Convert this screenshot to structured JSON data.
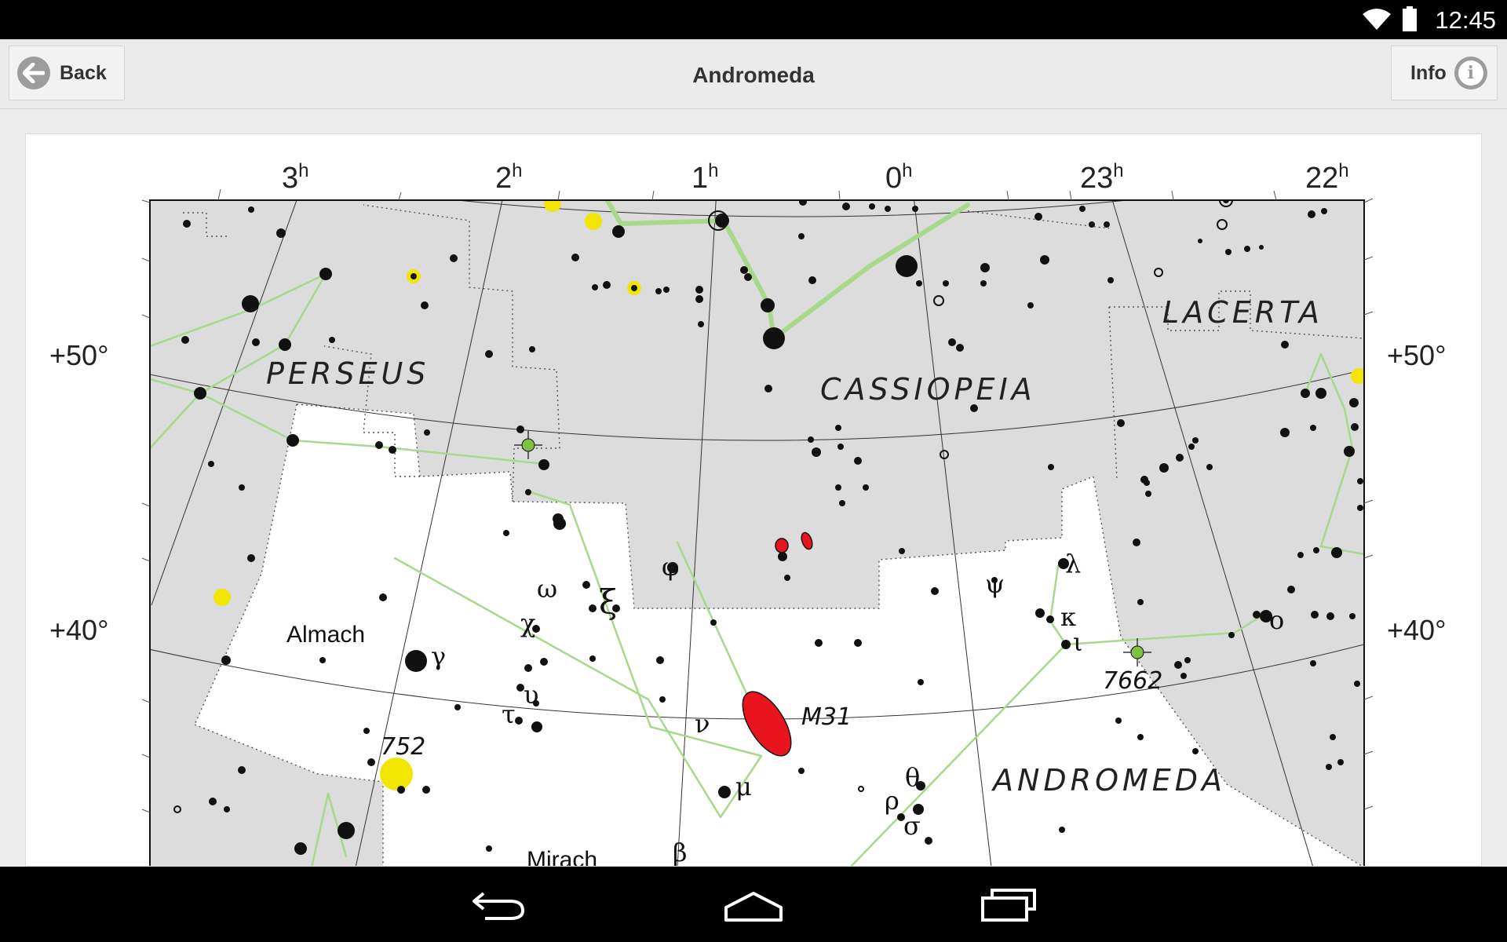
{
  "status_bar": {
    "time": "12:45",
    "icons": [
      "wifi-icon",
      "battery-icon"
    ]
  },
  "action_bar": {
    "title": "Andromeda",
    "back_label": "Back",
    "info_label": "Info",
    "back_icon": "arrow-left-icon",
    "info_icon": "info-icon"
  },
  "star_map": {
    "ra_labels": [
      {
        "h": "3",
        "sup": "h"
      },
      {
        "h": "2",
        "sup": "h"
      },
      {
        "h": "1",
        "sup": "h"
      },
      {
        "h": "0",
        "sup": "h"
      },
      {
        "h": "23",
        "sup": "h"
      },
      {
        "h": "22",
        "sup": "h"
      }
    ],
    "dec_labels": [
      "+50°",
      "+40°"
    ],
    "constellations": [
      "PERSEUS",
      "CASSIOPEIA",
      "LACERTA",
      "ANDROMEDA"
    ],
    "star_names": [
      "Almach",
      "Mirach"
    ],
    "greek_labels": [
      "γ",
      "φ",
      "ω",
      "ξ",
      "χ",
      "υ",
      "τ",
      "ν",
      "μ",
      "β",
      "λ",
      "ψ",
      "κ",
      "ι",
      "ο",
      "θ",
      "ρ",
      "σ"
    ],
    "deep_sky_labels": [
      "752",
      "M31",
      "7662"
    ],
    "colors": {
      "background": "#dcdcdc",
      "andromeda_fill": "#ffffff",
      "figure_line": "#a6d98a",
      "star": "#111111",
      "open_cluster": "#f2e500",
      "galaxy": "#e8141e",
      "nebula": "#7fc241"
    }
  },
  "nav_bar": {
    "buttons": [
      "nav-back-icon",
      "nav-home-icon",
      "nav-recents-icon"
    ]
  }
}
